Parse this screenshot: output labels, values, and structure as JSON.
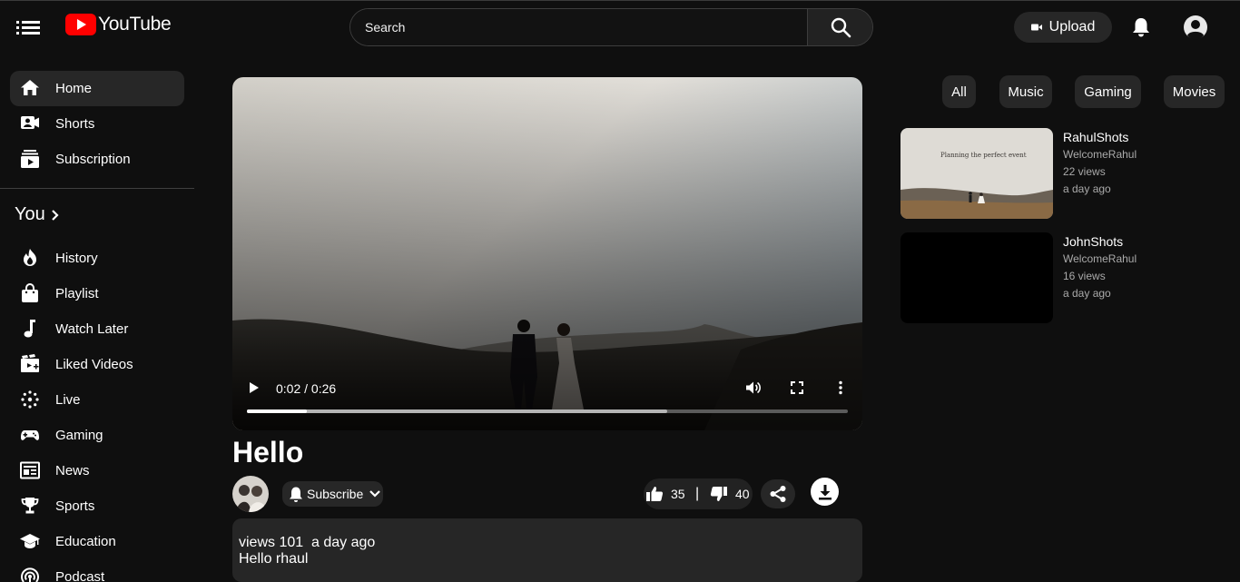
{
  "brand": {
    "name": "YouTube",
    "accent": "#ff0000"
  },
  "search": {
    "placeholder": "Search"
  },
  "header": {
    "upload_label": "Upload"
  },
  "sidebar": {
    "items": [
      {
        "label": "Home",
        "icon": "home-icon",
        "active": true
      },
      {
        "label": "Shorts",
        "icon": "shorts-icon"
      },
      {
        "label": "Subscription",
        "icon": "subscription-icon"
      }
    ],
    "you_heading": "You",
    "you_items": [
      {
        "label": "History",
        "icon": "history-icon"
      },
      {
        "label": "Playlist",
        "icon": "playlist-icon"
      },
      {
        "label": "Watch Later",
        "icon": "watch-later-icon"
      },
      {
        "label": "Liked Videos",
        "icon": "liked-videos-icon"
      },
      {
        "label": "Live",
        "icon": "live-icon"
      },
      {
        "label": "Gaming",
        "icon": "gaming-icon"
      },
      {
        "label": "News",
        "icon": "news-icon"
      },
      {
        "label": "Sports",
        "icon": "sports-icon"
      },
      {
        "label": "Education",
        "icon": "education-icon"
      },
      {
        "label": "Podcast",
        "icon": "podcast-icon"
      }
    ]
  },
  "player": {
    "time_display": "0:02 / 0:26",
    "played_fraction": 0.1,
    "buffered_fraction": 0.7
  },
  "video": {
    "title": "Hello",
    "subscribe_label": "Subscribe",
    "likes": "35",
    "separator": "|",
    "dislikes": "40",
    "views_line": "views 101  a day ago",
    "description": "Hello rhaul"
  },
  "chips": [
    "All",
    "Music",
    "Gaming",
    "Movies"
  ],
  "recommendations": [
    {
      "title": "RahulShots",
      "channel": "WelcomeRahul",
      "views": "22 views",
      "time": "a day ago",
      "thumb_text": "Planning the perfect event"
    },
    {
      "title": "JohnShots",
      "channel": "WelcomeRahul",
      "views": "16 views",
      "time": "a day ago"
    }
  ]
}
